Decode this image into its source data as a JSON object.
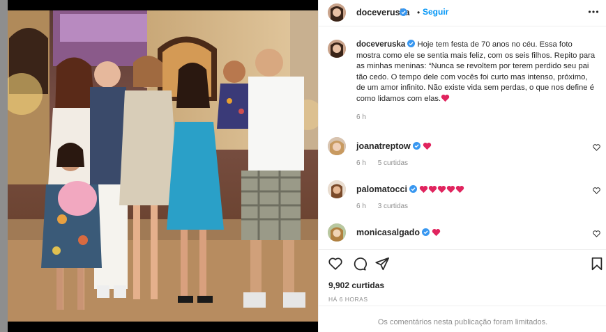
{
  "post": {
    "image_alt": "Foto de família em uma festa",
    "author": {
      "username": "doceveruska",
      "verified": true,
      "follow_label": "Seguir",
      "separator": "•"
    },
    "caption": {
      "username": "doceveruska",
      "text": "Hoje tem festa de 70 anos no céu. Essa foto mostra como ele se sentia mais feliz, com os seis filhos. Repito para as minhas meninas: “Nunca se revoltem por terem perdido seu pai tão cedo. O tempo dele com vocês foi curto mas intenso, próximo, de um amor infinito. Não existe vida sem perdas, o que nos define é como lidamos com elas.",
      "emoji": "heart",
      "time": "6 h"
    },
    "comments": [
      {
        "username": "joanatreptow",
        "verified": true,
        "hearts": 1,
        "time": "6 h",
        "likes": "5 curtidas"
      },
      {
        "username": "palomatocci",
        "verified": true,
        "hearts": 5,
        "time": "6 h",
        "likes": "3 curtidas"
      },
      {
        "username": "monicasalgado",
        "verified": true,
        "hearts": 1,
        "time": "",
        "likes": ""
      }
    ],
    "like_count": "9,902 curtidas",
    "posted_ago": "HÁ 6 HORAS",
    "comments_limited": "Os comentários nesta publicação foram limitados."
  },
  "icons": {
    "more": "more-horizontal-icon",
    "like": "heart-outline-icon",
    "comment": "comment-bubble-icon",
    "share": "send-plane-icon",
    "save": "bookmark-icon",
    "verified": "verified-badge-icon"
  },
  "colors": {
    "accent": "#0095f6",
    "verified": "#3897f0",
    "heart": "#ed4956",
    "muted": "#8e8e8e",
    "text": "#262626"
  }
}
